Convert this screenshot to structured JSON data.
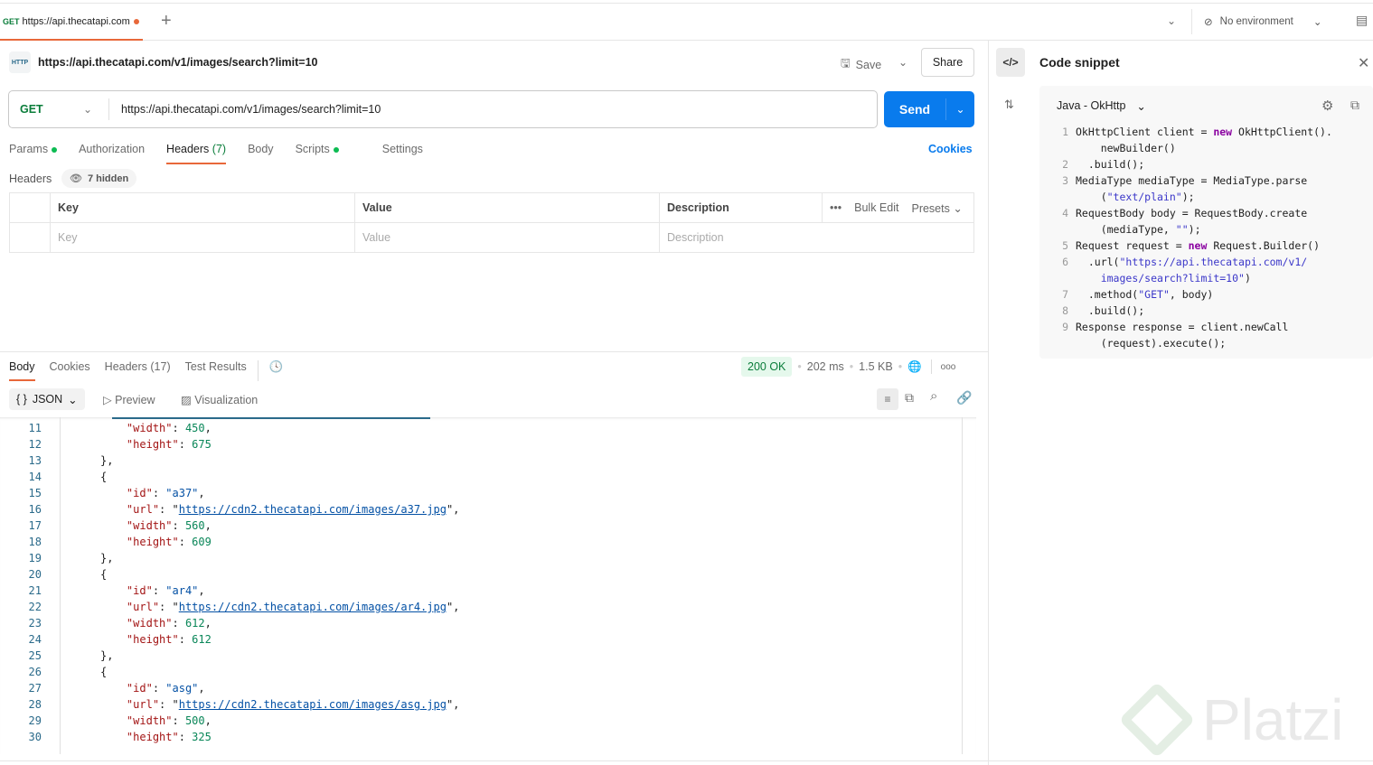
{
  "tab": {
    "method": "GET",
    "title": "https://api.thecatapi.com",
    "add": "+"
  },
  "env": {
    "label": "No environment"
  },
  "request": {
    "name": "https://api.thecatapi.com/v1/images/search?limit=10",
    "save": "Save",
    "share": "Share",
    "method": "GET",
    "url": "https://api.thecatapi.com/v1/images/search?limit=10",
    "send": "Send",
    "tabs": [
      {
        "label": "Params"
      },
      {
        "label": "Authorization"
      },
      {
        "label": "Headers",
        "count": "(7)"
      },
      {
        "label": "Body"
      },
      {
        "label": "Scripts"
      },
      {
        "label": "Settings"
      }
    ],
    "cookies": "Cookies",
    "headers_label": "Headers",
    "hidden": "7 hidden",
    "table": {
      "cols": [
        "Key",
        "Value",
        "Description"
      ],
      "bulk": "Bulk Edit",
      "presets": "Presets",
      "placeholders": [
        "Key",
        "Value",
        "Description"
      ]
    }
  },
  "response": {
    "tabs": [
      "Body",
      "Cookies",
      "Headers (17)",
      "Test Results"
    ],
    "status": "200 OK",
    "time": "202 ms",
    "size": "1.5 KB",
    "format": "JSON",
    "preview": "Preview",
    "visualization": "Visualization",
    "lines": [
      {
        "n": "11",
        "i": 2,
        "t": [
          [
            "\"width\"",
            "key"
          ],
          [
            ": ",
            "pun"
          ],
          [
            "450",
            "num"
          ],
          [
            ",",
            "pun"
          ]
        ]
      },
      {
        "n": "12",
        "i": 2,
        "t": [
          [
            "\"height\"",
            "key"
          ],
          [
            ": ",
            "pun"
          ],
          [
            "675",
            "num"
          ]
        ]
      },
      {
        "n": "13",
        "i": 1,
        "t": [
          [
            "},",
            "pun"
          ]
        ]
      },
      {
        "n": "14",
        "i": 1,
        "t": [
          [
            "{",
            "pun"
          ]
        ]
      },
      {
        "n": "15",
        "i": 2,
        "t": [
          [
            "\"id\"",
            "key"
          ],
          [
            ": ",
            "pun"
          ],
          [
            "\"a37\"",
            "str"
          ],
          [
            ",",
            "pun"
          ]
        ]
      },
      {
        "n": "16",
        "i": 2,
        "t": [
          [
            "\"url\"",
            "key"
          ],
          [
            ": \"",
            "pun"
          ],
          [
            "https://cdn2.thecatapi.com/images/a37.jpg",
            "link"
          ],
          [
            "\",",
            "pun"
          ]
        ]
      },
      {
        "n": "17",
        "i": 2,
        "t": [
          [
            "\"width\"",
            "key"
          ],
          [
            ": ",
            "pun"
          ],
          [
            "560",
            "num"
          ],
          [
            ",",
            "pun"
          ]
        ]
      },
      {
        "n": "18",
        "i": 2,
        "t": [
          [
            "\"height\"",
            "key"
          ],
          [
            ": ",
            "pun"
          ],
          [
            "609",
            "num"
          ]
        ]
      },
      {
        "n": "19",
        "i": 1,
        "t": [
          [
            "},",
            "pun"
          ]
        ]
      },
      {
        "n": "20",
        "i": 1,
        "t": [
          [
            "{",
            "pun"
          ]
        ]
      },
      {
        "n": "21",
        "i": 2,
        "t": [
          [
            "\"id\"",
            "key"
          ],
          [
            ": ",
            "pun"
          ],
          [
            "\"ar4\"",
            "str"
          ],
          [
            ",",
            "pun"
          ]
        ]
      },
      {
        "n": "22",
        "i": 2,
        "t": [
          [
            "\"url\"",
            "key"
          ],
          [
            ": \"",
            "pun"
          ],
          [
            "https://cdn2.thecatapi.com/images/ar4.jpg",
            "link"
          ],
          [
            "\",",
            "pun"
          ]
        ]
      },
      {
        "n": "23",
        "i": 2,
        "t": [
          [
            "\"width\"",
            "key"
          ],
          [
            ": ",
            "pun"
          ],
          [
            "612",
            "num"
          ],
          [
            ",",
            "pun"
          ]
        ]
      },
      {
        "n": "24",
        "i": 2,
        "t": [
          [
            "\"height\"",
            "key"
          ],
          [
            ": ",
            "pun"
          ],
          [
            "612",
            "num"
          ]
        ]
      },
      {
        "n": "25",
        "i": 1,
        "t": [
          [
            "},",
            "pun"
          ]
        ]
      },
      {
        "n": "26",
        "i": 1,
        "t": [
          [
            "{",
            "pun"
          ]
        ]
      },
      {
        "n": "27",
        "i": 2,
        "t": [
          [
            "\"id\"",
            "key"
          ],
          [
            ": ",
            "pun"
          ],
          [
            "\"asg\"",
            "str"
          ],
          [
            ",",
            "pun"
          ]
        ]
      },
      {
        "n": "28",
        "i": 2,
        "t": [
          [
            "\"url\"",
            "key"
          ],
          [
            ": \"",
            "pun"
          ],
          [
            "https://cdn2.thecatapi.com/images/asg.jpg",
            "link"
          ],
          [
            "\",",
            "pun"
          ]
        ]
      },
      {
        "n": "29",
        "i": 2,
        "t": [
          [
            "\"width\"",
            "key"
          ],
          [
            ": ",
            "pun"
          ],
          [
            "500",
            "num"
          ],
          [
            ",",
            "pun"
          ]
        ]
      },
      {
        "n": "30",
        "i": 2,
        "t": [
          [
            "\"height\"",
            "key"
          ],
          [
            ": ",
            "pun"
          ],
          [
            "325",
            "num"
          ]
        ]
      }
    ]
  },
  "snippet": {
    "title": "Code snippet",
    "language": "Java - OkHttp",
    "lines": [
      {
        "n": "1",
        "t": [
          [
            "OkHttpClient client = ",
            ""
          ],
          [
            "new",
            "kw"
          ],
          [
            " OkHttpClient().",
            ""
          ]
        ]
      },
      {
        "n": "",
        "t": [
          [
            "    newBuilder()",
            ""
          ]
        ]
      },
      {
        "n": "2",
        "t": [
          [
            "  .build();",
            ""
          ]
        ]
      },
      {
        "n": "3",
        "t": [
          [
            "MediaType mediaType = MediaType.parse",
            ""
          ]
        ]
      },
      {
        "n": "",
        "t": [
          [
            "    (",
            ""
          ],
          [
            "\"text/plain\"",
            "cstr"
          ],
          [
            ");",
            ""
          ]
        ]
      },
      {
        "n": "4",
        "t": [
          [
            "RequestBody body = RequestBody.create",
            ""
          ]
        ]
      },
      {
        "n": "",
        "t": [
          [
            "    (mediaType, ",
            ""
          ],
          [
            "\"\"",
            "cstr"
          ],
          [
            ");",
            ""
          ]
        ]
      },
      {
        "n": "5",
        "t": [
          [
            "Request request = ",
            ""
          ],
          [
            "new",
            "kw"
          ],
          [
            " Request.Builder()",
            ""
          ]
        ]
      },
      {
        "n": "6",
        "t": [
          [
            "  .url(",
            ""
          ],
          [
            "\"https://api.thecatapi.com/v1/",
            "cstr"
          ]
        ]
      },
      {
        "n": "",
        "t": [
          [
            "    ",
            ""
          ],
          [
            "images/search?limit=10\"",
            "cstr"
          ],
          [
            ")",
            ""
          ]
        ]
      },
      {
        "n": "7",
        "t": [
          [
            "  .method(",
            ""
          ],
          [
            "\"GET\"",
            "cstr"
          ],
          [
            ", body)",
            ""
          ]
        ]
      },
      {
        "n": "8",
        "t": [
          [
            "  .build();",
            ""
          ]
        ]
      },
      {
        "n": "9",
        "t": [
          [
            "Response response = client.newCall",
            ""
          ]
        ]
      },
      {
        "n": "",
        "t": [
          [
            "    (request).execute();",
            ""
          ]
        ]
      }
    ]
  },
  "watermark": "Platzi"
}
